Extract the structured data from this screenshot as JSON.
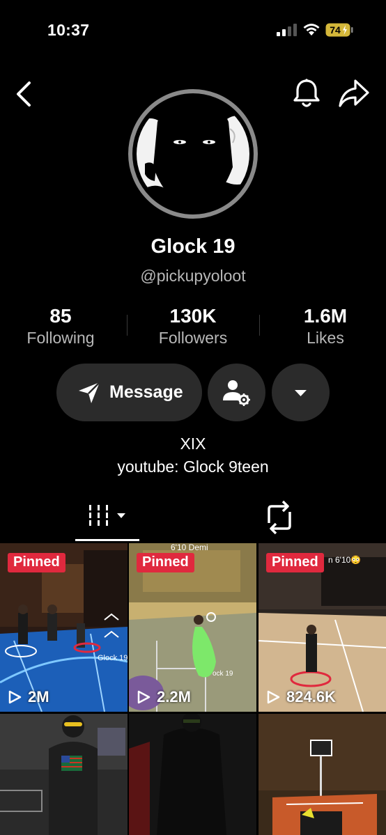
{
  "status_bar": {
    "time": "10:37",
    "battery": "74"
  },
  "nav": {
    "back_icon": "chevron-left-icon",
    "bell_icon": "bell-icon",
    "share_icon": "share-icon"
  },
  "profile": {
    "display_name": "Glock 19",
    "handle": "@pickupyoloot",
    "bio_line1": "XIX",
    "bio_line2": "youtube: Glock 9teen"
  },
  "stats": {
    "following_count": "85",
    "following_label": "Following",
    "followers_count": "130K",
    "followers_label": "Followers",
    "likes_count": "1.6M",
    "likes_label": "Likes"
  },
  "actions": {
    "message_label": "Message"
  },
  "tabs": [
    {
      "icon": "videos-grid-icon",
      "active": true
    },
    {
      "icon": "repost-icon",
      "active": false
    }
  ],
  "videos": [
    {
      "pinned_label": "Pinned",
      "views": "2M"
    },
    {
      "pinned_label": "Pinned",
      "views": "2.2M",
      "overlay_text": "6'10 Demi"
    },
    {
      "pinned_label": "Pinned",
      "views": "824.6K",
      "overlay_text": "n 6'10😳"
    },
    {
      "views": ""
    },
    {
      "views": ""
    },
    {
      "views": ""
    }
  ],
  "colors": {
    "background": "#000000",
    "pill": "#2b2b2b",
    "pinned_badge": "#e0293e",
    "secondary_text": "#b8b8b8"
  }
}
